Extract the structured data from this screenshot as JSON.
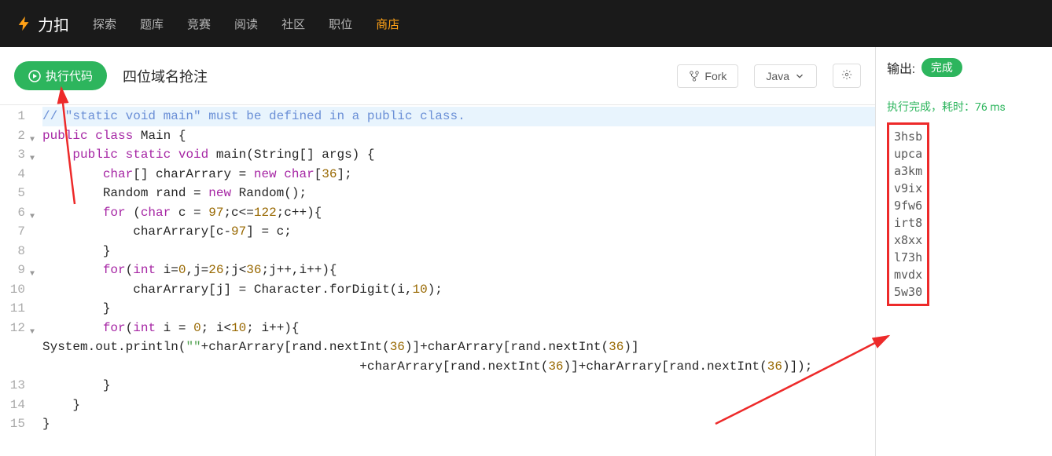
{
  "nav": {
    "logo_text": "力扣",
    "items": [
      "探索",
      "题库",
      "竞赛",
      "阅读",
      "社区",
      "职位",
      "商店"
    ],
    "active_index": 6
  },
  "toolbar": {
    "run_label": "执行代码",
    "title": "四位域名抢注",
    "fork_label": "Fork",
    "language_label": "Java"
  },
  "editor": {
    "lines": [
      {
        "n": 1,
        "hl": true,
        "fold": false,
        "html": "<span class=\"cm-comment\">// \"static void main\" must be defined in a public class.</span>"
      },
      {
        "n": 2,
        "fold": true,
        "html": "<span class=\"cm-kw\">public</span> <span class=\"cm-kw\">class</span> Main {"
      },
      {
        "n": 3,
        "fold": true,
        "html": "    <span class=\"cm-kw\">public</span> <span class=\"cm-kw\">static</span> <span class=\"cm-type\">void</span> main(String[] args) {"
      },
      {
        "n": 4,
        "fold": false,
        "html": "        <span class=\"cm-type\">char</span>[] charArrary = <span class=\"cm-kw\">new</span> <span class=\"cm-type\">char</span>[<span class=\"cm-num\">36</span>];"
      },
      {
        "n": 5,
        "fold": false,
        "html": "        Random rand = <span class=\"cm-kw\">new</span> Random();"
      },
      {
        "n": 6,
        "fold": true,
        "html": "        <span class=\"cm-kw\">for</span> (<span class=\"cm-type\">char</span> c = <span class=\"cm-num\">97</span>;c&lt;=<span class=\"cm-num\">122</span>;c++){"
      },
      {
        "n": 7,
        "fold": false,
        "html": "            charArrary[c-<span class=\"cm-num\">97</span>] = c;"
      },
      {
        "n": 8,
        "fold": false,
        "html": "        }"
      },
      {
        "n": 9,
        "fold": true,
        "html": "        <span class=\"cm-kw\">for</span>(<span class=\"cm-type\">int</span> i=<span class=\"cm-num\">0</span>,j=<span class=\"cm-num\">26</span>;j&lt;<span class=\"cm-num\">36</span>;j++,i++){"
      },
      {
        "n": 10,
        "fold": false,
        "html": "            charArrary[j] = Character.forDigit(i,<span class=\"cm-num\">10</span>);"
      },
      {
        "n": 11,
        "fold": false,
        "html": "        }"
      },
      {
        "n": 12,
        "fold": true,
        "html": "        <span class=\"cm-kw\">for</span>(<span class=\"cm-type\">int</span> i = <span class=\"cm-num\">0</span>; i&lt;<span class=\"cm-num\">10</span>; i++){"
      },
      {
        "n": "",
        "fold": false,
        "html": "System.out.println(<span class=\"cm-str\">\"\"</span>+charArrary[rand.nextInt(<span class=\"cm-num\">36</span>)]+charArrary[rand.nextInt(<span class=\"cm-num\">36</span>)]"
      },
      {
        "n": "",
        "fold": false,
        "html": "                                          +charArrary[rand.nextInt(<span class=\"cm-num\">36</span>)]+charArrary[rand.nextInt(<span class=\"cm-num\">36</span>)]);"
      },
      {
        "n": 13,
        "fold": false,
        "html": "        }"
      },
      {
        "n": 14,
        "fold": false,
        "html": "    }"
      },
      {
        "n": 15,
        "fold": false,
        "html": "}"
      }
    ]
  },
  "output": {
    "header_label": "输出:",
    "status_badge": "完成",
    "status_line": "执行完成，耗时：76 ms",
    "lines": [
      "3hsb",
      "upca",
      "a3km",
      "v9ix",
      "9fw6",
      "irt8",
      "x8xx",
      "l73h",
      "mvdx",
      "5w30"
    ]
  }
}
